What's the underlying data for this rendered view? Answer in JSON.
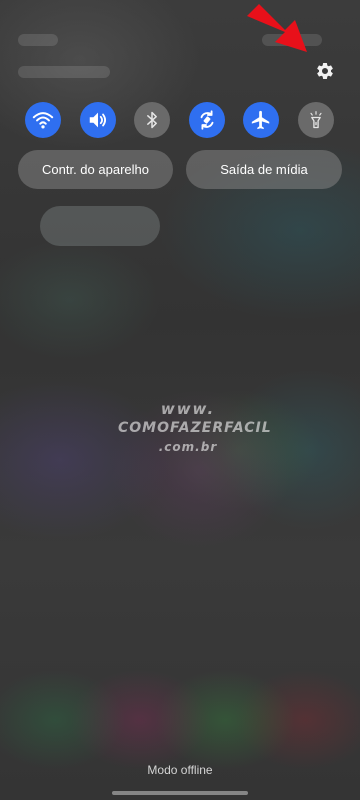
{
  "quick_toggles": [
    {
      "icon": "wifi-icon",
      "state": "on"
    },
    {
      "icon": "volume-icon",
      "state": "on"
    },
    {
      "icon": "bluetooth-icon",
      "state": "off"
    },
    {
      "icon": "auto-rotate-icon",
      "state": "on"
    },
    {
      "icon": "airplane-icon",
      "state": "on"
    },
    {
      "icon": "flashlight-icon",
      "state": "off"
    }
  ],
  "buttons": {
    "device_control": "Contr. do aparelho",
    "media_output": "Saída de mídia"
  },
  "watermark": {
    "line1": "www.",
    "line2": "COMOFAZERFACIL",
    "line3": ".com.br"
  },
  "status": {
    "network_text": "Modo offline"
  },
  "colors": {
    "toggle_on": "#2f6ff0",
    "toggle_off": "#6a6a6a",
    "arrow": "#e8101a"
  }
}
